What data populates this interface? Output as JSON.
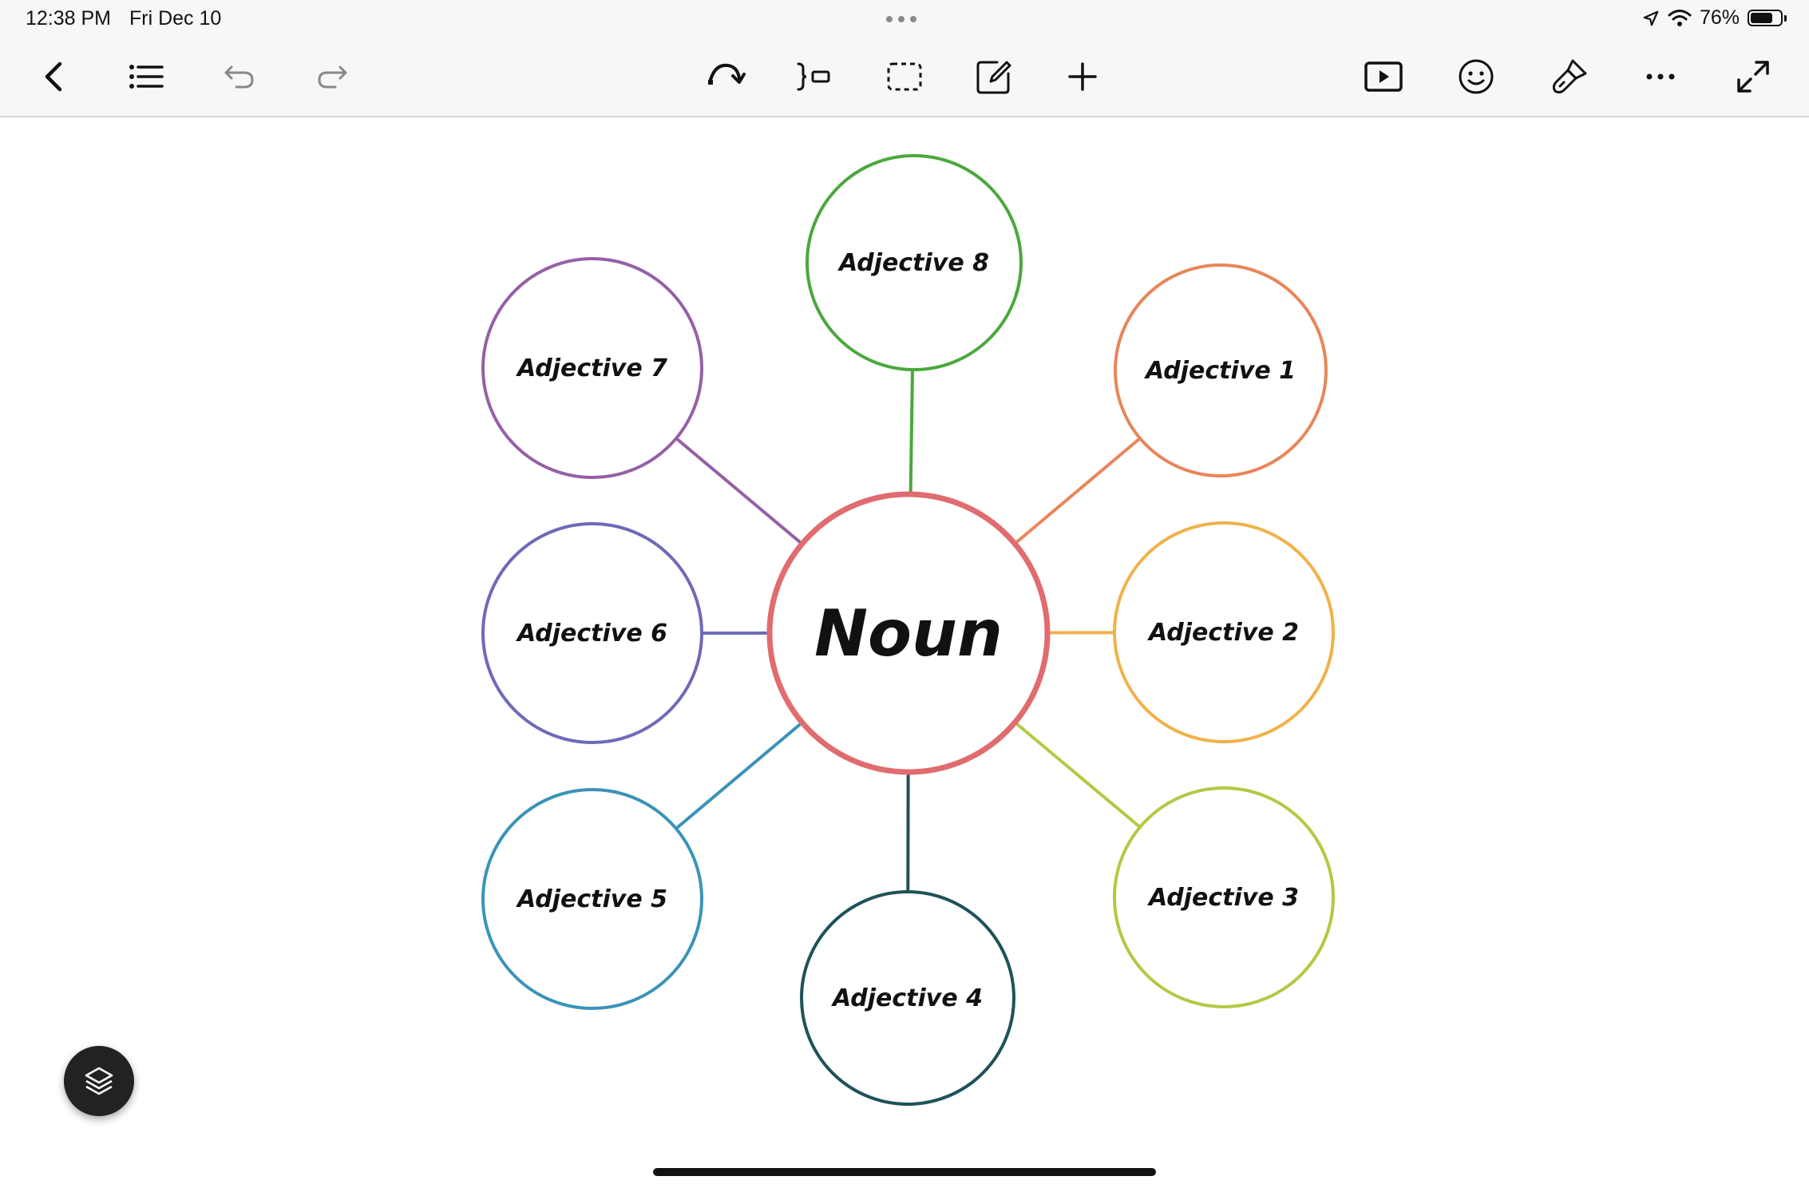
{
  "status_bar": {
    "time": "12:38 PM",
    "date": "Fri Dec 10",
    "battery_text": "76%",
    "battery_level": 0.76
  },
  "toolbar": {
    "left_icons": [
      "back-icon",
      "outline-list-icon",
      "undo-icon",
      "redo-icon"
    ],
    "center_icons": [
      "rotate-icon",
      "add-sibling-icon",
      "select-area-icon",
      "edit-icon",
      "add-icon"
    ],
    "right_icons": [
      "present-icon",
      "emoji-icon",
      "style-brush-icon",
      "more-icon",
      "fullscreen-icon"
    ]
  },
  "mind_map": {
    "central": {
      "label": "Noun",
      "color": "#e06c70"
    },
    "nodes": [
      {
        "label": "Adjective 1",
        "color": "#e8865a"
      },
      {
        "label": "Adjective 2",
        "color": "#f0b24a"
      },
      {
        "label": "Adjective 3",
        "color": "#b5c843"
      },
      {
        "label": "Adjective 4",
        "color": "#1f5258"
      },
      {
        "label": "Adjective 5",
        "color": "#3a93b8"
      },
      {
        "label": "Adjective 6",
        "color": "#6e6ab8"
      },
      {
        "label": "Adjective 7",
        "color": "#9560a6"
      },
      {
        "label": "Adjective 8",
        "color": "#4aa83c"
      }
    ]
  },
  "layers_button_icon": "layers-icon"
}
